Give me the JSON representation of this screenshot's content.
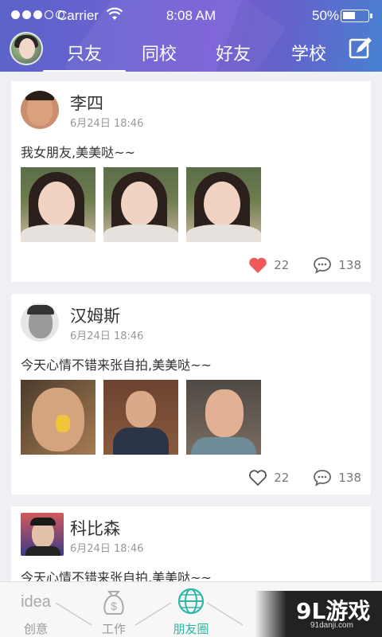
{
  "status": {
    "carrier": "Carrier",
    "time": "8:08 AM",
    "battery": "50%"
  },
  "nav": {
    "tabs": [
      "只友",
      "同校",
      "好友",
      "学校"
    ],
    "active_index": 0
  },
  "posts": [
    {
      "name": "李四",
      "date": "6月24日 18:46",
      "text": "我女朋友,美美哒~~",
      "likes": "22",
      "comments": "138",
      "liked": true
    },
    {
      "name": "汉姆斯",
      "date": "6月24日 18:46",
      "text": "今天心情不错来张自拍,美美哒~~",
      "likes": "22",
      "comments": "138",
      "liked": false
    },
    {
      "name": "科比森",
      "date": "6月24日 18:46",
      "text": "今天心情不错来张自拍,美美哒~~"
    }
  ],
  "bottom_tabs": [
    {
      "label": "创意",
      "icon": "idea-icon"
    },
    {
      "label": "工作",
      "icon": "money-bag-icon"
    },
    {
      "label": "朋友圈",
      "icon": "globe-icon",
      "active": true
    }
  ],
  "watermark": {
    "big": "9L游戏",
    "small": "91danji.com"
  },
  "colors": {
    "like": "#f05a5a",
    "active_tab": "#2eb6a6"
  }
}
